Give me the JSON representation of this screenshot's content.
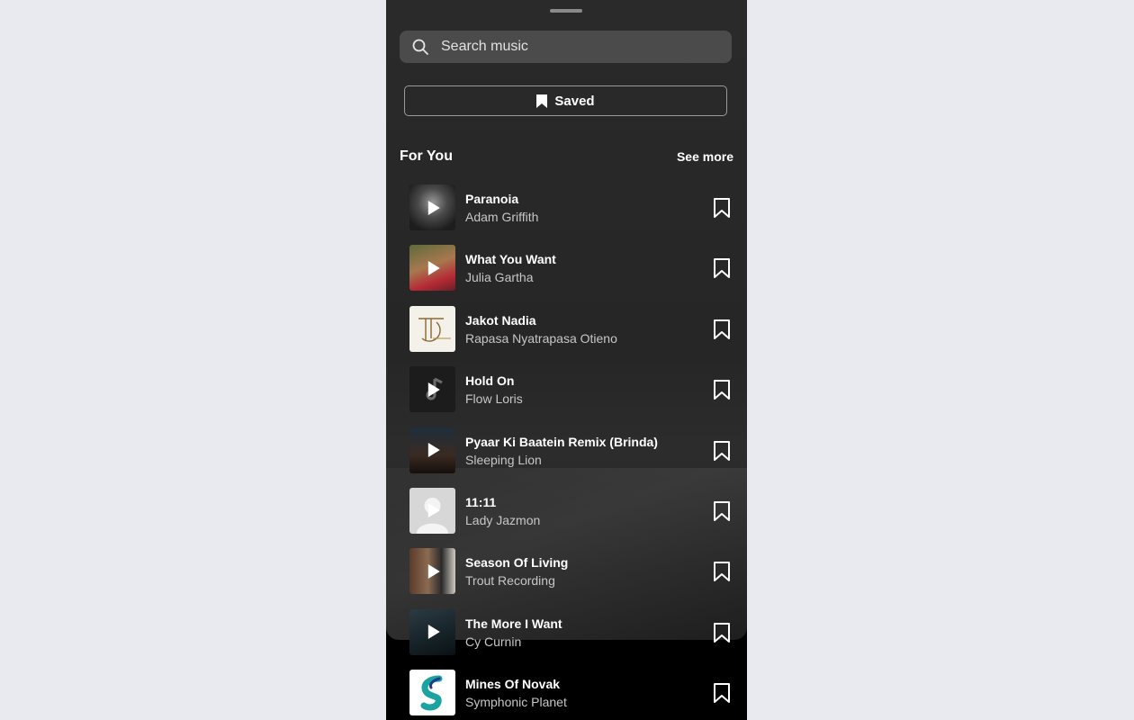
{
  "search": {
    "placeholder": "Search music"
  },
  "saved_button": {
    "label": "Saved"
  },
  "section": {
    "title": "For You",
    "see_more": "See more"
  },
  "tracks": [
    {
      "title": "Paranoia",
      "artist": "Adam Griffith"
    },
    {
      "title": "What You Want",
      "artist": "Julia Gartha"
    },
    {
      "title": "Jakot Nadia",
      "artist": "Rapasa Nyatrapasa Otieno"
    },
    {
      "title": "Hold On",
      "artist": "Flow Loris"
    },
    {
      "title": "Pyaar Ki Baatein Remix (Brinda)",
      "artist": "Sleeping Lion"
    },
    {
      "title": "11:11",
      "artist": "Lady Jazmon"
    },
    {
      "title": "Season Of Living",
      "artist": "Trout Recording"
    },
    {
      "title": "The More I Want",
      "artist": "Cy Curnin"
    },
    {
      "title": "Mines Of Novak",
      "artist": "Symphonic Planet"
    }
  ],
  "icons": {
    "search": "search-icon",
    "saved": "bookmark-filled-icon",
    "play": "play-icon",
    "bookmark": "bookmark-outline-icon"
  },
  "colors": {
    "page_background": "#e9eaf0",
    "sheet_background": "#2a2a2a",
    "search_background": "#4b4b4b",
    "accent_logo": "#1aa3a0"
  }
}
